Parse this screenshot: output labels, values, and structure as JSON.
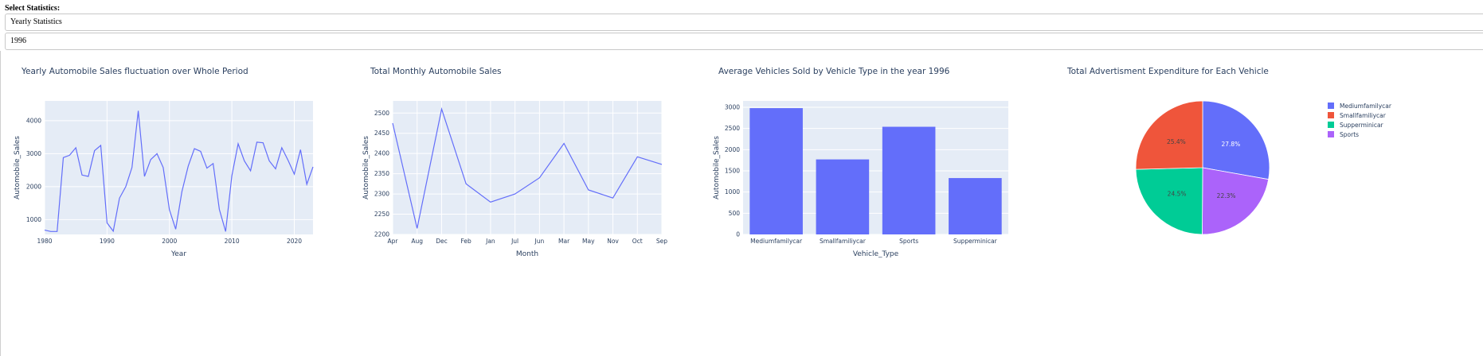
{
  "controls": {
    "label": "Select Statistics:",
    "statistic_selected": "Yearly Statistics",
    "year_selected": "1996"
  },
  "colors": {
    "plot_bg": "#e5ecf6",
    "line": "#636efa",
    "bar": "#636efa",
    "pie": [
      "#636efa",
      "#ef553b",
      "#00cc96",
      "#ab63fa"
    ],
    "text": "#2a3f5f"
  },
  "chart_data": [
    {
      "type": "line",
      "title": "Yearly Automobile Sales fluctuation over Whole Period",
      "xlabel": "Year",
      "ylabel": "Automobile_Sales",
      "xlim": [
        1980,
        2023
      ],
      "ylim": [
        550,
        4600
      ],
      "xticks": [
        1980,
        1990,
        2000,
        2010,
        2020
      ],
      "yticks": [
        1000,
        2000,
        3000,
        4000
      ],
      "x": [
        1980,
        1981,
        1982,
        1983,
        1984,
        1985,
        1986,
        1987,
        1988,
        1989,
        1990,
        1991,
        1992,
        1993,
        1994,
        1995,
        1996,
        1997,
        1998,
        1999,
        2000,
        2001,
        2002,
        2003,
        2004,
        2005,
        2006,
        2007,
        2008,
        2009,
        2010,
        2011,
        2012,
        2013,
        2014,
        2015,
        2016,
        2017,
        2018,
        2019,
        2020,
        2021,
        2022,
        2023
      ],
      "y": [
        680,
        640,
        640,
        2880,
        2950,
        3180,
        2350,
        2310,
        3090,
        3250,
        900,
        650,
        1650,
        2000,
        2580,
        4300,
        2310,
        2820,
        3000,
        2580,
        1300,
        710,
        1850,
        2620,
        3150,
        3070,
        2560,
        2700,
        1310,
        640,
        2330,
        3300,
        2780,
        2480,
        3350,
        3330,
        2780,
        2540,
        3180,
        2800,
        2380,
        3120,
        2070,
        2600
      ]
    },
    {
      "type": "line",
      "title": "Total Monthly Automobile Sales",
      "xlabel": "Month",
      "ylabel": "Automobile_Sales",
      "ylim": [
        2200,
        2530
      ],
      "yticks": [
        2200,
        2250,
        2300,
        2350,
        2400,
        2450,
        2500
      ],
      "categories": [
        "Apr",
        "Aug",
        "Dec",
        "Feb",
        "Jan",
        "Jul",
        "Jun",
        "Mar",
        "May",
        "Nov",
        "Oct",
        "Sep"
      ],
      "values": [
        2475,
        2215,
        2510,
        2325,
        2280,
        2300,
        2340,
        2425,
        2310,
        2290,
        2392,
        2373
      ]
    },
    {
      "type": "bar",
      "title": "Average Vehicles Sold by Vehicle Type in the year 1996",
      "xlabel": "Vehicle_Type",
      "ylabel": "Automobile_Sales",
      "ylim": [
        0,
        3150
      ],
      "yticks": [
        0,
        500,
        1000,
        1500,
        2000,
        2500,
        3000
      ],
      "categories": [
        "Mediumfamilycar",
        "Smallfamiliycar",
        "Sports",
        "Supperminicar"
      ],
      "values": [
        2980,
        1770,
        2540,
        1330
      ]
    },
    {
      "type": "pie",
      "title": "Total Advertisment Expenditure for Each Vehicle",
      "labels": [
        "Mediumfamilycar",
        "Smallfamiliycar",
        "Supperminicar",
        "Sports"
      ],
      "values": [
        27.8,
        25.4,
        24.5,
        22.3
      ],
      "value_labels": [
        "27.8%",
        "25.4%",
        "24.5%",
        "22.3%"
      ],
      "slice_order": [
        0,
        3,
        2,
        1
      ],
      "legend_position": "right"
    }
  ]
}
